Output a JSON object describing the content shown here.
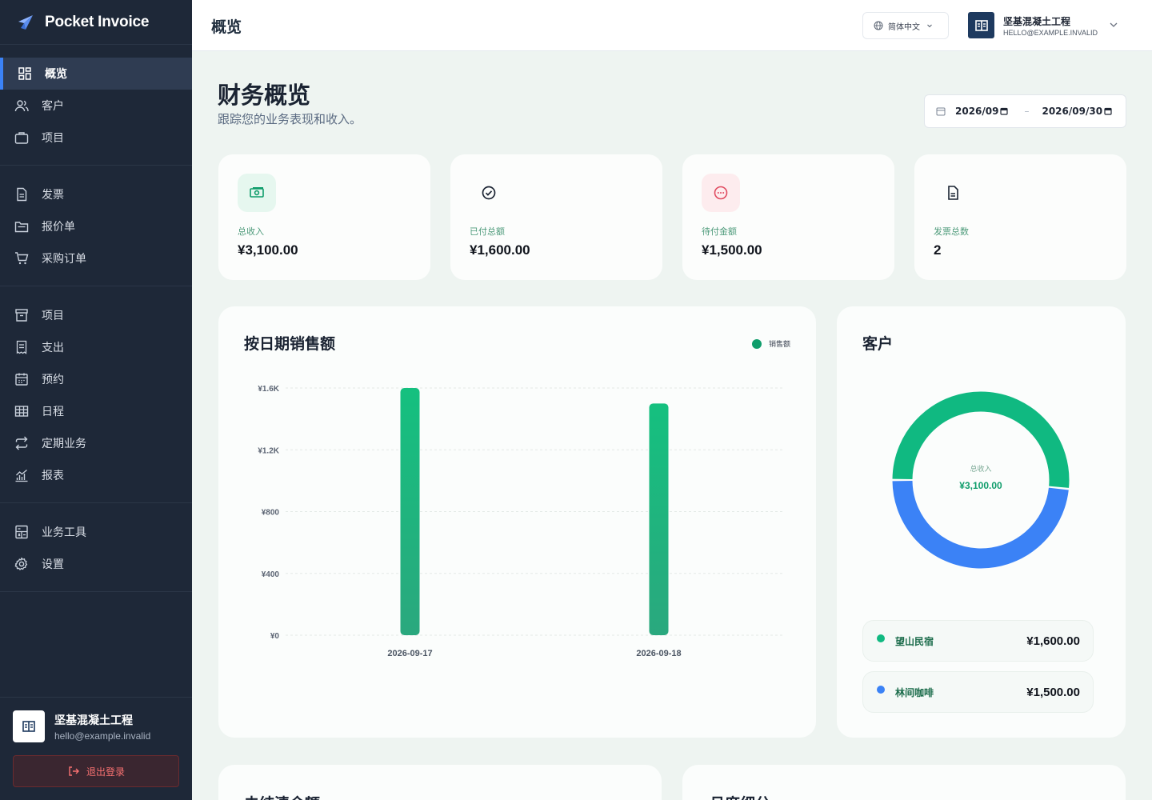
{
  "app": {
    "name": "Pocket Invoice"
  },
  "sidebar": {
    "groups": [
      [
        {
          "label": "概览",
          "icon": "dashboard-icon",
          "active": true
        },
        {
          "label": "客户",
          "icon": "users-icon"
        },
        {
          "label": "项目",
          "icon": "briefcase-icon"
        }
      ],
      [
        {
          "label": "发票",
          "icon": "document-icon"
        },
        {
          "label": "报价单",
          "icon": "folder-open-icon"
        },
        {
          "label": "采购订单",
          "icon": "cart-icon"
        }
      ],
      [
        {
          "label": "项目",
          "icon": "archive-icon"
        },
        {
          "label": "支出",
          "icon": "receipt-icon"
        },
        {
          "label": "预约",
          "icon": "calendar-icon"
        },
        {
          "label": "日程",
          "icon": "table-icon"
        },
        {
          "label": "定期业务",
          "icon": "repeat-icon"
        },
        {
          "label": "报表",
          "icon": "chart-icon"
        }
      ],
      [
        {
          "label": "业务工具",
          "icon": "calculator-icon"
        },
        {
          "label": "设置",
          "icon": "gear-icon"
        }
      ]
    ],
    "footer": {
      "name": "坚基混凝土工程",
      "email": "hello@example.invalid",
      "logout": "退出登录"
    }
  },
  "topbar": {
    "title": "概览",
    "language": "简体中文",
    "account_name": "坚基混凝土工程",
    "account_email": "HELLO@EXAMPLE.INVALID"
  },
  "page": {
    "title": "财务概览",
    "subtitle": "跟踪您的业务表现和收入。",
    "date_from": "2026/09",
    "date_to": "2026/09/30",
    "date_sep": "–"
  },
  "stats": [
    {
      "label": "总收入",
      "value": "¥3,100.00",
      "icon": "cash-icon",
      "icon_bg": "#e6f7ef",
      "icon_color": "#0f9d6b",
      "label_color": "#4d9a7a"
    },
    {
      "label": "已付总额",
      "value": "¥1,600.00",
      "icon": "check-circle-icon",
      "icon_bg": "#fcfdfc",
      "icon_color": "#1a2332",
      "label_color": "#4d9a7a"
    },
    {
      "label": "待付金额",
      "value": "¥1,500.00",
      "icon": "dots-circle-icon",
      "icon_bg": "#fdecee",
      "icon_color": "#e04a5f",
      "label_color": "#4d9a7a"
    },
    {
      "label": "发票总数",
      "value": "2",
      "icon": "file-icon",
      "icon_bg": "#fcfdfc",
      "icon_color": "#1a2332",
      "label_color": "#4d9a7a"
    }
  ],
  "sales_panel": {
    "title": "按日期销售额",
    "legend": "销售额"
  },
  "customers_panel": {
    "title": "客户",
    "center_label": "总收入",
    "center_value": "¥3,100.00",
    "rows": [
      {
        "name": "望山民宿",
        "value": "¥1,600.00",
        "color": "#10b981"
      },
      {
        "name": "林间咖啡",
        "value": "¥1,500.00",
        "color": "#3b82f6"
      }
    ]
  },
  "bottom": {
    "left_title": "未结清余额",
    "right_title": "月度细分"
  },
  "chart_data": [
    {
      "type": "bar",
      "title": "按日期销售额",
      "categories": [
        "2026-09-17",
        "2026-09-18"
      ],
      "series": [
        {
          "name": "销售额",
          "values": [
            1600,
            1500
          ]
        }
      ],
      "yticks": [
        "¥0",
        "¥400",
        "¥800",
        "¥1.2K",
        "¥1.6K"
      ],
      "ylim": [
        0,
        1600
      ],
      "grid": true,
      "legend_position": "top-right",
      "color": "#1bb37f"
    },
    {
      "type": "pie",
      "title": "客户",
      "labels": [
        "望山民宿",
        "林间咖啡"
      ],
      "values": [
        1600,
        1500
      ],
      "colors": [
        "#10b981",
        "#3b82f6"
      ]
    }
  ]
}
